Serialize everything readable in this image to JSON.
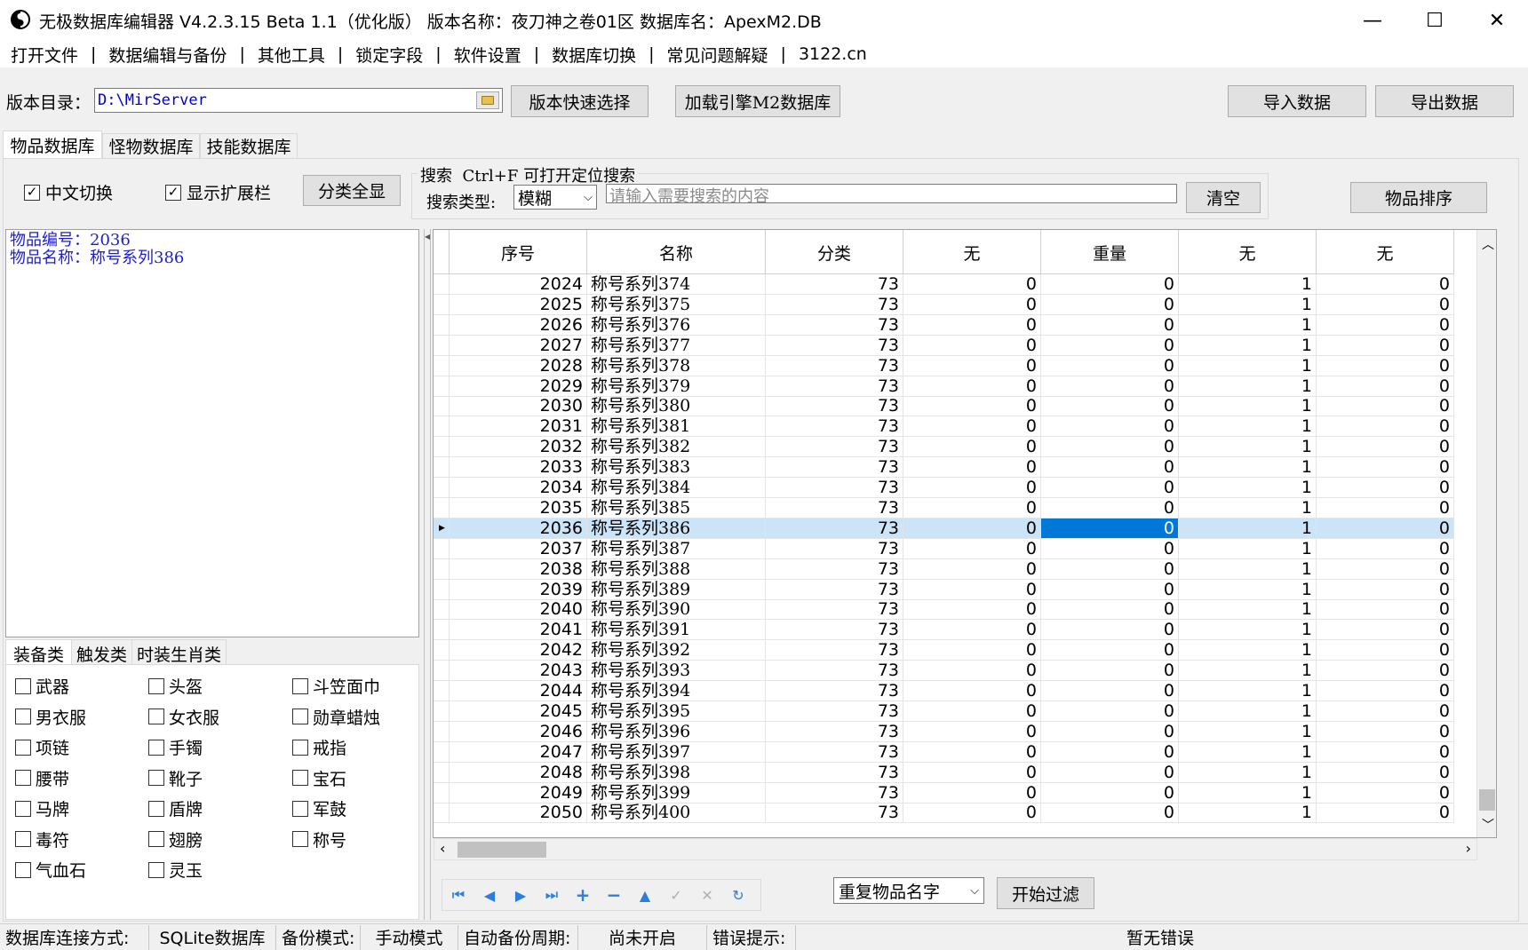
{
  "window": {
    "title": "无极数据库编辑器 V4.2.3.15    Beta 1.1（优化版）    版本名称：夜刀神之卷01区    数据库名：ApexM2.DB",
    "min": "—",
    "max": "☐",
    "close": "✕"
  },
  "menu": [
    "打开文件",
    "数据编辑与备份",
    "其他工具",
    "锁定字段",
    "软件设置",
    "数据库切换",
    "常见问题解疑",
    "3122.cn"
  ],
  "menu_sep": "|",
  "toolbar": {
    "dir_label": "版本目录：",
    "dir_value": "D:\\MirServer",
    "quick_select": "版本快速选择",
    "load_db": "加载引擎M2数据库",
    "import": "导入数据",
    "export": "导出数据"
  },
  "tabs": [
    "物品数据库",
    "怪物数据库",
    "技能数据库"
  ],
  "options": {
    "chinese_switch": "中文切换",
    "show_ext": "显示扩展栏",
    "show_all": "分类全显",
    "check_mark": "✓"
  },
  "search": {
    "group_title": "搜索  Ctrl+F 可打开定位搜索",
    "type_label": "搜索类型:",
    "type_value": "模糊",
    "placeholder": "请输入需要搜索的内容",
    "clear": "清空",
    "sort": "物品排序"
  },
  "info": {
    "line1": "物品编号：2036",
    "line2": "物品名称：称号系列386"
  },
  "cat_tabs": [
    "装备类",
    "触发类",
    "时装生肖类"
  ],
  "categories": [
    "武器",
    "头盔",
    "斗笠面巾",
    "男衣服",
    "女衣服",
    "勋章蜡烛",
    "项链",
    "手镯",
    "戒指",
    "腰带",
    "靴子",
    "宝石",
    "马牌",
    "盾牌",
    "军鼓",
    "毒符",
    "翅膀",
    "称号",
    "气血石",
    "灵玉"
  ],
  "grid": {
    "headers": [
      "序号",
      "名称",
      "分类",
      "无",
      "重量",
      "无",
      "无"
    ],
    "rows": [
      [
        "2024",
        "称号系列374",
        "73",
        "0",
        "0",
        "1",
        "0"
      ],
      [
        "2025",
        "称号系列375",
        "73",
        "0",
        "0",
        "1",
        "0"
      ],
      [
        "2026",
        "称号系列376",
        "73",
        "0",
        "0",
        "1",
        "0"
      ],
      [
        "2027",
        "称号系列377",
        "73",
        "0",
        "0",
        "1",
        "0"
      ],
      [
        "2028",
        "称号系列378",
        "73",
        "0",
        "0",
        "1",
        "0"
      ],
      [
        "2029",
        "称号系列379",
        "73",
        "0",
        "0",
        "1",
        "0"
      ],
      [
        "2030",
        "称号系列380",
        "73",
        "0",
        "0",
        "1",
        "0"
      ],
      [
        "2031",
        "称号系列381",
        "73",
        "0",
        "0",
        "1",
        "0"
      ],
      [
        "2032",
        "称号系列382",
        "73",
        "0",
        "0",
        "1",
        "0"
      ],
      [
        "2033",
        "称号系列383",
        "73",
        "0",
        "0",
        "1",
        "0"
      ],
      [
        "2034",
        "称号系列384",
        "73",
        "0",
        "0",
        "1",
        "0"
      ],
      [
        "2035",
        "称号系列385",
        "73",
        "0",
        "0",
        "1",
        "0"
      ],
      [
        "2036",
        "称号系列386",
        "73",
        "0",
        "0",
        "1",
        "0"
      ],
      [
        "2037",
        "称号系列387",
        "73",
        "0",
        "0",
        "1",
        "0"
      ],
      [
        "2038",
        "称号系列388",
        "73",
        "0",
        "0",
        "1",
        "0"
      ],
      [
        "2039",
        "称号系列389",
        "73",
        "0",
        "0",
        "1",
        "0"
      ],
      [
        "2040",
        "称号系列390",
        "73",
        "0",
        "0",
        "1",
        "0"
      ],
      [
        "2041",
        "称号系列391",
        "73",
        "0",
        "0",
        "1",
        "0"
      ],
      [
        "2042",
        "称号系列392",
        "73",
        "0",
        "0",
        "1",
        "0"
      ],
      [
        "2043",
        "称号系列393",
        "73",
        "0",
        "0",
        "1",
        "0"
      ],
      [
        "2044",
        "称号系列394",
        "73",
        "0",
        "0",
        "1",
        "0"
      ],
      [
        "2045",
        "称号系列395",
        "73",
        "0",
        "0",
        "1",
        "0"
      ],
      [
        "2046",
        "称号系列396",
        "73",
        "0",
        "0",
        "1",
        "0"
      ],
      [
        "2047",
        "称号系列397",
        "73",
        "0",
        "0",
        "1",
        "0"
      ],
      [
        "2048",
        "称号系列398",
        "73",
        "0",
        "0",
        "1",
        "0"
      ],
      [
        "2049",
        "称号系列399",
        "73",
        "0",
        "0",
        "1",
        "0"
      ],
      [
        "2050",
        "称号系列400",
        "73",
        "0",
        "0",
        "1",
        "0"
      ]
    ],
    "selected_index": 12
  },
  "filter": {
    "select_value": "重复物品名字",
    "start": "开始过滤"
  },
  "status": {
    "conn_label": "数据库连接方式:",
    "conn_value": "SQLite数据库",
    "backup_label": "备份模式:",
    "backup_value": "手动模式",
    "auto_label": "自动备份周期:",
    "auto_value": "尚未开启",
    "error_label": "错误提示:",
    "error_value": "暂无错误"
  }
}
